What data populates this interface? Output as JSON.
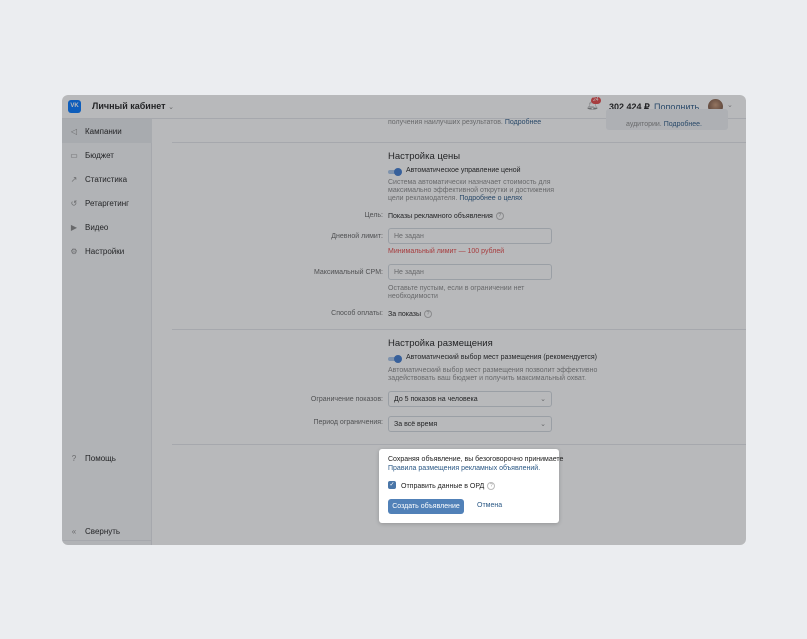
{
  "header": {
    "logo": "VK",
    "title": "Личный кабинет",
    "notifications": "24",
    "balance": "302 424 ₽",
    "topup": "Пополнить"
  },
  "sidebar": {
    "items": [
      {
        "label": "Кампании",
        "icon": "megaphone-icon"
      },
      {
        "label": "Бюджет",
        "icon": "wallet-icon"
      },
      {
        "label": "Статистика",
        "icon": "chart-icon"
      },
      {
        "label": "Ретаргетинг",
        "icon": "retarget-icon"
      },
      {
        "label": "Видео",
        "icon": "video-icon"
      },
      {
        "label": "Настройки",
        "icon": "gear-icon"
      }
    ],
    "help": "Помощь",
    "collapse": "Свернуть"
  },
  "top": {
    "text": "получения наилучших результатов.",
    "link": "Подробнее",
    "box_text": "аудитории.",
    "box_link": "Подробнее."
  },
  "price": {
    "title": "Настройка цены",
    "toggle": "Автоматическое управление ценой",
    "desc": "Система автоматически назначает стоимость для максимально эффективной открутки и достижения цели рекламодателя.",
    "desc_link": "Подробнее о целях",
    "goal_label": "Цель:",
    "goal_value": "Показы рекламного объявления",
    "daily_label": "Дневной лимит:",
    "daily_placeholder": "Не задан",
    "daily_error": "Минимальный лимит — 100 рублей",
    "cpm_label": "Максимальный CPM:",
    "cpm_placeholder": "Не задан",
    "cpm_hint": "Оставьте пустым, если в ограничении нет необходимости",
    "pay_label": "Способ оплаты:",
    "pay_value": "За показы"
  },
  "placement": {
    "title": "Настройка размещения",
    "toggle": "Автоматический выбор мест размещения (рекомендуется)",
    "desc": "Автоматический выбор мест размещения позволит эффективно задействовать ваш бюджет и получить максимальный охват.",
    "limit_label": "Ограничение показов:",
    "limit_value": "До 5 показов на человека",
    "period_label": "Период ограничения:",
    "period_value": "За всё время"
  },
  "popup": {
    "text": "Сохраняя объявление, вы безоговорочно принимаете",
    "link": "Правила размещения рекламных объявлений.",
    "checkbox": "Отправить данные в ОРД",
    "checked": true,
    "create": "Создать объявление",
    "cancel": "Отмена"
  }
}
